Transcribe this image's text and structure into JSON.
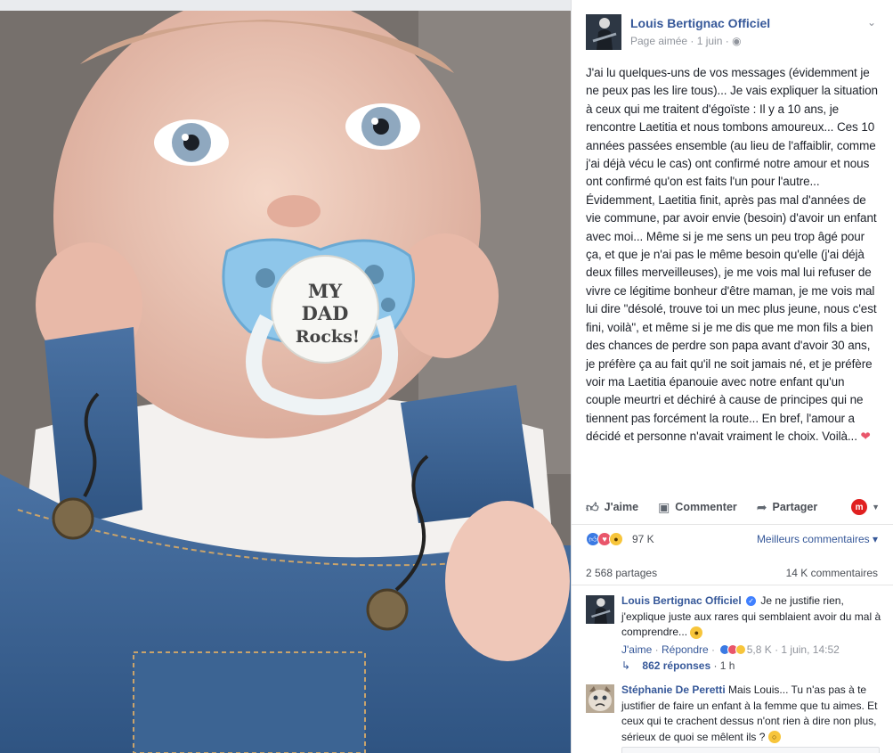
{
  "photo": {
    "pacifier_lines": [
      "MY",
      "DAD",
      "Rocks!"
    ]
  },
  "post": {
    "page_name": "Louis Bertignac Officiel",
    "meta": "Page aimée · 1 juin ·",
    "text": "J'ai lu quelques-uns de vos messages (évidemment je ne peux pas les lire tous)... Je vais expliquer la situation à ceux qui me traitent d'égoïste : Il y a 10 ans, je rencontre Laetitia et nous tombons amoureux... Ces 10 années passées ensemble (au lieu de l'affaiblir, comme j'ai déjà vécu le cas) ont confirmé notre amour et nous ont confirmé qu'on est faits l'un pour l'autre... Évidemment, Laetitia finit, après pas mal d'années de vie commune, par avoir envie (besoin) d'avoir un enfant avec moi... Même si je me sens un peu trop âgé pour ça, et que je n'ai pas le même besoin qu'elle (j'ai déjà deux filles merveilleuses), je me vois mal lui refuser de vivre ce légitime bonheur d'être maman, je me vois mal lui dire \"désolé, trouve toi un mec plus jeune, nous c'est fini, voilà\", et même si je me dis que me mon fils a bien des chances de perdre son papa avant d'avoir 30 ans, je préfère ça au fait qu'il ne soit jamais né, et je préfère voir ma Laetitia épanouie avec notre enfant qu'un couple meurtri et déchiré à cause de principes qui ne tiennent pas forcément la route... En bref, l'amour a décidé et personne n'avait vraiment le choix. Voilà...",
    "heart": "❤"
  },
  "actions": {
    "like": "J'aime",
    "comment": "Commenter",
    "share": "Partager",
    "badge": "m"
  },
  "stats": {
    "reactions_count": "97 K",
    "sort_label": "Meilleurs commentaires",
    "shares": "2 568 partages",
    "comments": "14 K commentaires"
  },
  "comments": [
    {
      "author": "Louis Bertignac Officiel",
      "text": "Je ne justifie rien, j'explique juste aux rares qui semblaient avoir du mal à comprendre...",
      "like": "J'aime",
      "reply": "Répondre",
      "reactions": "5,8 K",
      "time": "1 juin, 14:52",
      "replies_label": "862 réponses",
      "replies_time": "1 h"
    },
    {
      "author": "Stéphanie De Peretti",
      "text": "Mais Louis... Tu n'as pas à te justifier de faire un enfant à la femme que tu aimes. Et ceux qui te crachent dessus n'ont rien à dire non plus, sérieux de quoi se mêlent ils ?"
    }
  ],
  "colors": {
    "link": "#365899",
    "muted": "#90949c",
    "like_blue": "#3b7ae3",
    "love_red": "#e9566b",
    "wow_yellow": "#f7c53b"
  }
}
